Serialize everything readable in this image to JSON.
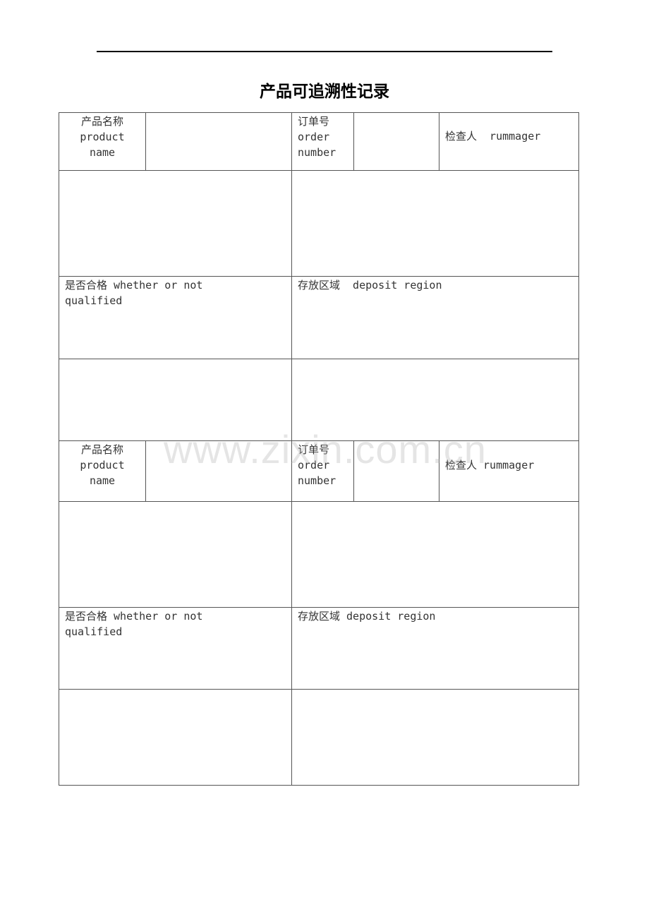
{
  "document": {
    "title": "产品可追溯性记录",
    "watermark": "www.zixin.com.cn"
  },
  "records": [
    {
      "product_name_cn": "产品名称",
      "product_name_en1": "product",
      "product_name_en2": "name",
      "product_name_value": "",
      "order_number_cn": "订单号",
      "order_number_en1": "order",
      "order_number_en2": "number",
      "order_number_value": "",
      "rummager_label": "检查人  rummager",
      "left_blank_1": "",
      "right_blank_1": "",
      "qualified_line1": "是否合格 whether or not",
      "qualified_line2": "qualified",
      "deposit_label": "存放区域  deposit region",
      "left_blank_2": "",
      "right_blank_2": ""
    },
    {
      "product_name_cn": "产品名称",
      "product_name_en1": "product",
      "product_name_en2": "name",
      "product_name_value": "",
      "order_number_cn": "订单号",
      "order_number_en1": "order",
      "order_number_en2": "number",
      "order_number_value": "",
      "rummager_label": "检查人 rummager",
      "left_blank_1": "",
      "right_blank_1": "",
      "qualified_line1": "是否合格 whether or not",
      "qualified_line2": "qualified",
      "deposit_label": "存放区域 deposit region",
      "left_blank_2": "",
      "right_blank_2": ""
    }
  ]
}
